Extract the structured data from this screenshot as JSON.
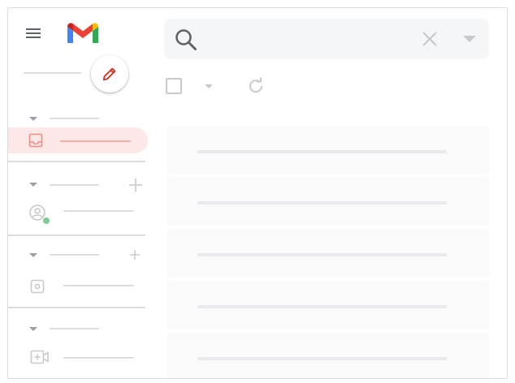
{
  "header": {
    "menu_icon": "hamburger-menu-icon",
    "logo": "gmail-logo",
    "logo_colors": {
      "blue": "#4285F4",
      "red": "#EA4335",
      "yellow": "#FBBC04",
      "green": "#34A853",
      "darkred": "#C5221F"
    }
  },
  "compose": {
    "icon": "pencil-icon",
    "icon_color": "#d93025"
  },
  "sidebar": {
    "sections": [
      {
        "name": "mail",
        "items": [
          "inbox"
        ],
        "has_add": false
      },
      {
        "name": "chat",
        "items": [
          "chat-person"
        ],
        "has_add": true,
        "status_color": "#81c995"
      },
      {
        "name": "spaces",
        "items": [
          "space"
        ],
        "has_add": true
      },
      {
        "name": "meet",
        "items": [
          "new-meeting"
        ],
        "has_add": false
      }
    ],
    "active_color": "#fce8e6"
  },
  "search": {
    "icon": "search-icon",
    "clear_icon": "close-icon",
    "options_icon": "caret-down-icon"
  },
  "toolbar": {
    "select_icon": "checkbox-icon",
    "dropdown_icon": "caret-down-icon",
    "refresh_icon": "refresh-icon"
  },
  "message_list": {
    "row_count": 5
  }
}
